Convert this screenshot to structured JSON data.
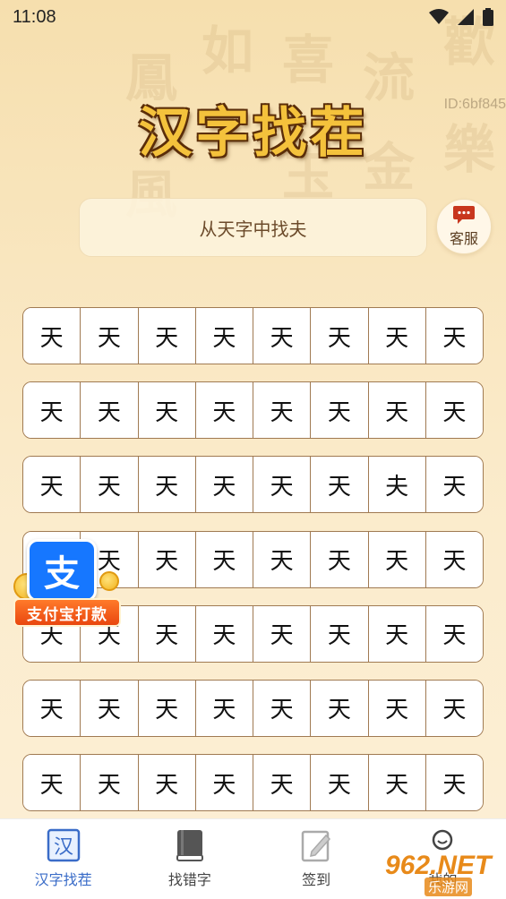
{
  "status_bar": {
    "time": "11:08"
  },
  "background_calligraphy": [
    "歡",
    "樂",
    "鳳",
    "如",
    "喜",
    "流",
    "金",
    "玉",
    "風"
  ],
  "header": {
    "title": "汉字找茬",
    "user_id": "ID:6bf845"
  },
  "prompt": {
    "text": "从天字中找夫"
  },
  "service": {
    "label": "客服",
    "icon": "chat-bubble-icon"
  },
  "grid": {
    "rows": [
      [
        "天",
        "天",
        "天",
        "天",
        "天",
        "天",
        "天",
        "天"
      ],
      [
        "天",
        "天",
        "天",
        "天",
        "天",
        "天",
        "天",
        "天"
      ],
      [
        "天",
        "天",
        "天",
        "天",
        "天",
        "天",
        "夫",
        "天"
      ],
      [
        "天",
        "天",
        "天",
        "天",
        "天",
        "天",
        "天",
        "天"
      ],
      [
        "天",
        "天",
        "天",
        "天",
        "天",
        "天",
        "天",
        "天"
      ],
      [
        "天",
        "天",
        "天",
        "天",
        "天",
        "天",
        "天",
        "天"
      ],
      [
        "天",
        "天",
        "天",
        "天",
        "天",
        "天",
        "天",
        "天"
      ]
    ]
  },
  "alipay_badge": {
    "icon_char": "支",
    "label": "支付宝打款"
  },
  "tabbar": {
    "tabs": [
      {
        "label": "汉字找茬",
        "icon": "han-char-icon",
        "active": true
      },
      {
        "label": "找错字",
        "icon": "book-icon",
        "active": false
      },
      {
        "label": "签到",
        "icon": "sign-in-icon",
        "active": false
      },
      {
        "label": "我的",
        "icon": "profile-icon",
        "active": false
      }
    ]
  },
  "watermark": {
    "brand": "962.NET",
    "sub": "乐游网"
  },
  "colors": {
    "title_fill": "#f4c23c",
    "title_outline": "#5b2e0a",
    "grid_border": "#a07a52",
    "active_tab": "#3a6cc8",
    "alipay_blue": "#1677ff",
    "service_icon": "#c8361e"
  }
}
